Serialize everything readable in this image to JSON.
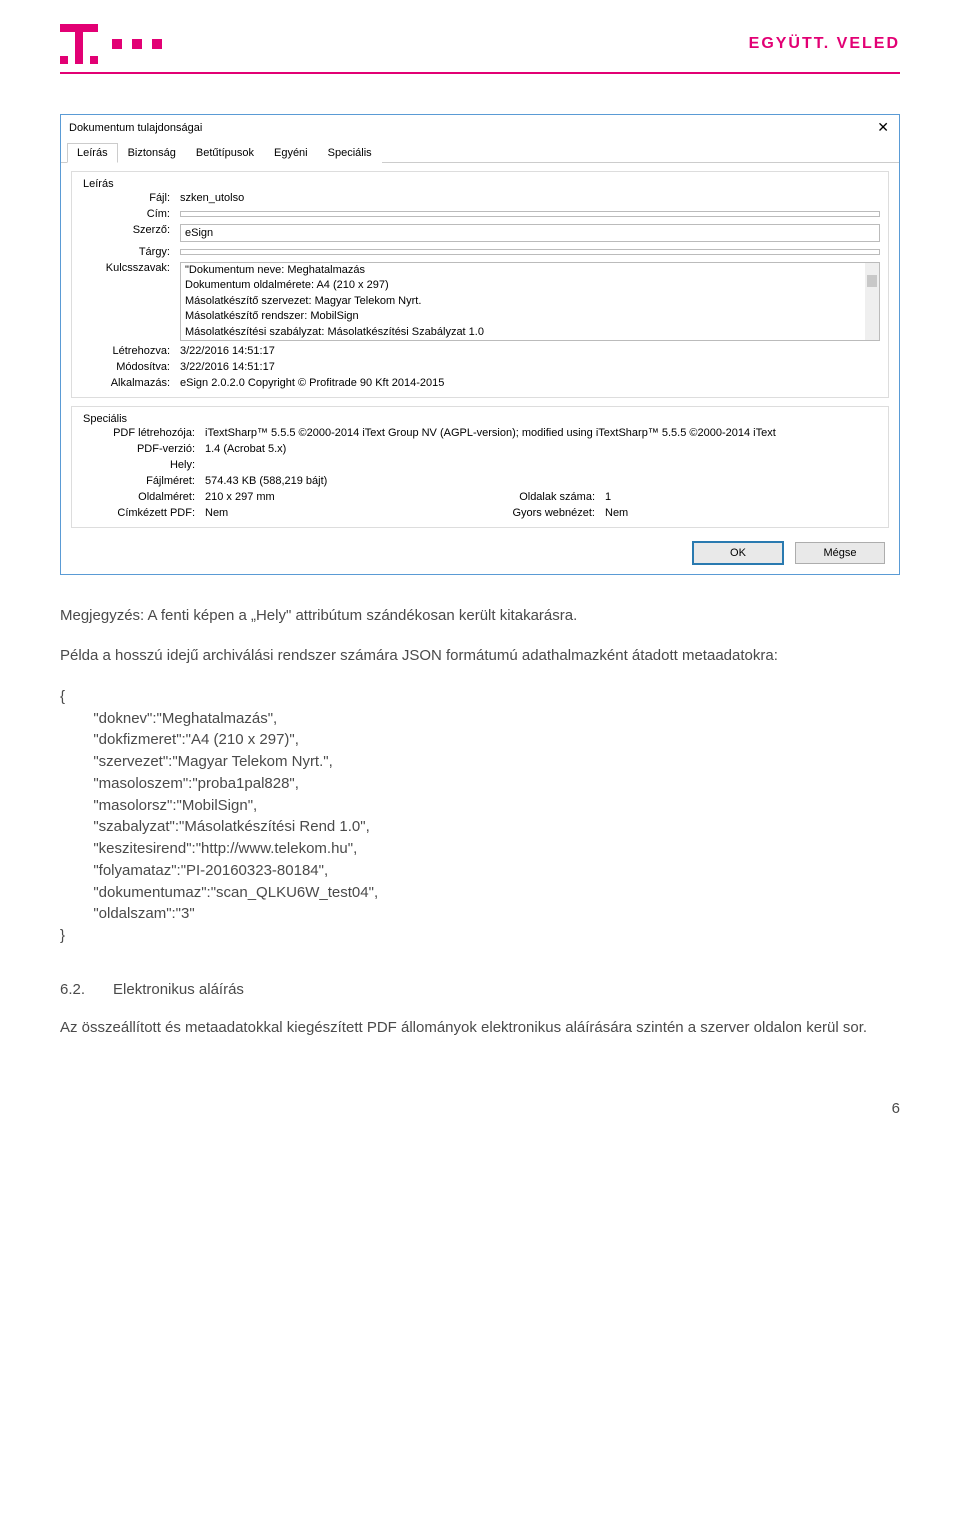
{
  "header": {
    "slogan": "EGYÜTT. VELED"
  },
  "dialog": {
    "title": "Dokumentum tulajdonságai",
    "tabs": [
      "Leírás",
      "Biztonság",
      "Betűtípusok",
      "Egyéni",
      "Speciális"
    ],
    "active_tab_index": 0,
    "description_legend": "Leírás",
    "labels": {
      "file": "Fájl:",
      "title_l": "Cím:",
      "author": "Szerző:",
      "subject": "Tárgy:",
      "keywords": "Kulcsszavak:",
      "created": "Létrehozva:",
      "modified": "Módosítva:",
      "application": "Alkalmazás:"
    },
    "values": {
      "file": "szken_utolso",
      "title_v": "",
      "author": "eSign",
      "subject": "",
      "keywords": [
        "\"Dokumentum neve: Meghatalmazás",
        "Dokumentum oldalmérete: A4 (210 x 297)",
        "Másolatkészítő szervezet: Magyar Telekom Nyrt.",
        "Másolatkészítő rendszer: MobilSign",
        "Másolatkészítési szabályzat: Másolatkészítési Szabályzat 1.0"
      ],
      "created": "3/22/2016 14:51:17",
      "modified": "3/22/2016 14:51:17",
      "application": "eSign 2.0.2.0 Copyright © Profitrade 90 Kft 2014-2015"
    },
    "special_legend": "Speciális",
    "special_labels": {
      "creator": "PDF létrehozója:",
      "version": "PDF-verzió:",
      "location": "Hely:",
      "filesize": "Fájlméret:",
      "pagesize": "Oldalméret:",
      "tagged": "Címkézett PDF:",
      "pages": "Oldalak száma:",
      "fastweb": "Gyors webnézet:"
    },
    "special_values": {
      "creator": "iTextSharp™ 5.5.5 ©2000-2014 iText Group NV (AGPL-version); modified using iTextSharp™ 5.5.5 ©2000-2014 iText",
      "version": "1.4 (Acrobat 5.x)",
      "location": "",
      "filesize": "574.43 KB (588,219 bájt)",
      "pagesize": "210 x 297 mm",
      "tagged": "Nem",
      "pages": "1",
      "fastweb": "Nem"
    },
    "buttons": {
      "ok": "OK",
      "cancel": "Mégse"
    }
  },
  "body": {
    "note": "Megjegyzés: A fenti képen a „Hely\" attribútum szándékosan került kitakarásra.",
    "json_intro": "Példa a hosszú idejű archiválási rendszer számára JSON formátumú adathalmazként átadott metaadatokra:",
    "json_block": "{\n        \"doknev\":\"Meghatalmazás\",\n        \"dokfizmeret\":\"A4 (210 x 297)\",\n        \"szervezet\":\"Magyar Telekom Nyrt.\",\n        \"masoloszem\":\"proba1pal828\",\n        \"masolorsz\":\"MobilSign\",\n        \"szabalyzat\":\"Másolatkészítési Rend 1.0\",\n        \"keszitesirend\":\"http://www.telekom.hu\",\n        \"folyamataz\":\"PI-20160323-80184\",\n        \"dokumentumaz\":\"scan_QLKU6W_test04\",\n        \"oldalszam\":\"3\"\n}",
    "section_num": "6.2.",
    "section_title": "Elektronikus aláírás",
    "section_body": "Az összeállított és metaadatokkal kiegészített PDF állományok elektronikus aláírására szintén a szerver oldalon kerül sor."
  },
  "page_number": "6"
}
